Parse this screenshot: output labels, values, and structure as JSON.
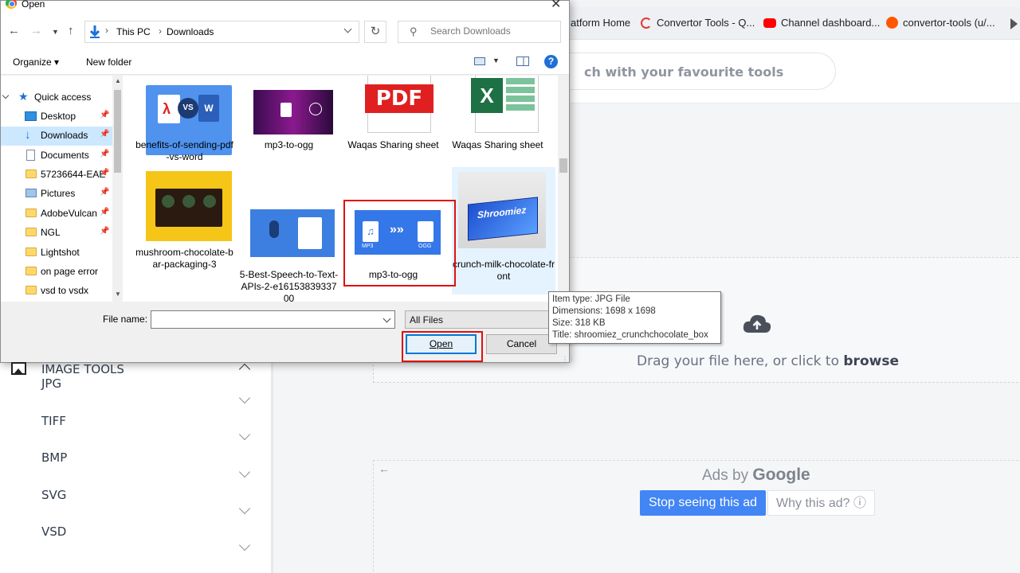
{
  "bookmarks": [
    {
      "label": "atform Home",
      "color": "#ffffff"
    },
    {
      "label": "Convertor Tools - Q...",
      "color": "#e53935"
    },
    {
      "label": "Channel dashboard...",
      "color": "#ff0000"
    },
    {
      "label": "convertor-tools (u/...",
      "color": "#ff5700"
    }
  ],
  "site": {
    "search_placeholder": "ch with your favourite tools",
    "sidebar_header": "IMAGE TOOLS",
    "sidebar_items": [
      "JPG",
      "TIFF",
      "BMP",
      "SVG",
      "VSD"
    ],
    "upload_text_prefix": "Drag your file here, or click to ",
    "upload_text_bold": "browse",
    "ads_by": "Ads by ",
    "ads_google": "Google",
    "stop_ad": "Stop seeing this ad",
    "why_ad": "Why this ad? ⓘ"
  },
  "dialog": {
    "title": "Open",
    "close": "✕",
    "address": {
      "root": "This PC",
      "sep": "›",
      "folder": "Downloads"
    },
    "search_placeholder": "Search Downloads",
    "organize": "Organize ▾",
    "new_folder": "New folder",
    "nav_pane": [
      {
        "label": "Quick access",
        "type": "star"
      },
      {
        "label": "Desktop",
        "type": "desktop",
        "pinned": true
      },
      {
        "label": "Downloads",
        "type": "download",
        "pinned": true,
        "selected": true
      },
      {
        "label": "Documents",
        "type": "doc",
        "pinned": true
      },
      {
        "label": "57236644-EAE",
        "type": "folder",
        "pinned": true
      },
      {
        "label": "Pictures",
        "type": "pic",
        "pinned": true
      },
      {
        "label": "AdobeVulcan",
        "type": "folder",
        "pinned": true
      },
      {
        "label": "NGL",
        "type": "folder",
        "pinned": true
      },
      {
        "label": "Lightshot",
        "type": "folder"
      },
      {
        "label": "on page error",
        "type": "folder"
      },
      {
        "label": "vsd to vsdx",
        "type": "folder"
      }
    ],
    "files": [
      {
        "name": "benefits-of-sending-pdf-vs-word"
      },
      {
        "name": "mp3-to-ogg"
      },
      {
        "name": "Waqas Sharing sheet"
      },
      {
        "name": "Waqas Sharing sheet"
      },
      {
        "name": "mushroom-chocolate-bar-packaging-3"
      },
      {
        "name": "5-Best-Speech-to-Text-APIs-2-e1615383933700"
      },
      {
        "name": "mp3-to-ogg"
      },
      {
        "name": "crunch-milk-chocolate-front"
      }
    ],
    "file_name_label": "File name:",
    "file_name_value": "",
    "file_type": "All Files",
    "open": "Open",
    "cancel": "Cancel",
    "tooltip": [
      "Item type: JPG File",
      "Dimensions: 1698 x 1698",
      "Size: 318 KB",
      "Title: shroomiez_crunchchocolate_box"
    ]
  },
  "colors": {
    "highlight": "#e01010",
    "accent": "#0078d7",
    "google_blue": "#4285f4"
  }
}
